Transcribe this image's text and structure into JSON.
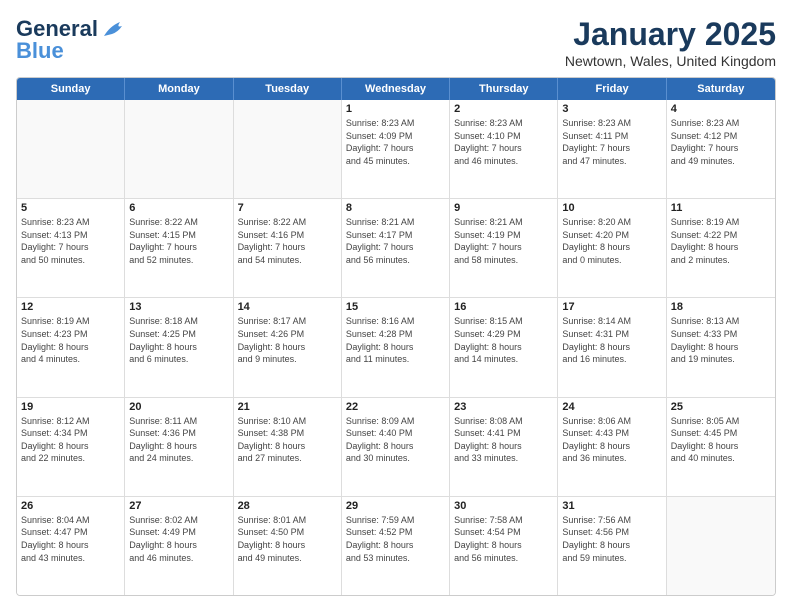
{
  "logo": {
    "line1": "General",
    "line2": "Blue"
  },
  "title": "January 2025",
  "subtitle": "Newtown, Wales, United Kingdom",
  "days": [
    "Sunday",
    "Monday",
    "Tuesday",
    "Wednesday",
    "Thursday",
    "Friday",
    "Saturday"
  ],
  "weeks": [
    [
      {
        "day": "",
        "info": ""
      },
      {
        "day": "",
        "info": ""
      },
      {
        "day": "",
        "info": ""
      },
      {
        "day": "1",
        "info": "Sunrise: 8:23 AM\nSunset: 4:09 PM\nDaylight: 7 hours\nand 45 minutes."
      },
      {
        "day": "2",
        "info": "Sunrise: 8:23 AM\nSunset: 4:10 PM\nDaylight: 7 hours\nand 46 minutes."
      },
      {
        "day": "3",
        "info": "Sunrise: 8:23 AM\nSunset: 4:11 PM\nDaylight: 7 hours\nand 47 minutes."
      },
      {
        "day": "4",
        "info": "Sunrise: 8:23 AM\nSunset: 4:12 PM\nDaylight: 7 hours\nand 49 minutes."
      }
    ],
    [
      {
        "day": "5",
        "info": "Sunrise: 8:23 AM\nSunset: 4:13 PM\nDaylight: 7 hours\nand 50 minutes."
      },
      {
        "day": "6",
        "info": "Sunrise: 8:22 AM\nSunset: 4:15 PM\nDaylight: 7 hours\nand 52 minutes."
      },
      {
        "day": "7",
        "info": "Sunrise: 8:22 AM\nSunset: 4:16 PM\nDaylight: 7 hours\nand 54 minutes."
      },
      {
        "day": "8",
        "info": "Sunrise: 8:21 AM\nSunset: 4:17 PM\nDaylight: 7 hours\nand 56 minutes."
      },
      {
        "day": "9",
        "info": "Sunrise: 8:21 AM\nSunset: 4:19 PM\nDaylight: 7 hours\nand 58 minutes."
      },
      {
        "day": "10",
        "info": "Sunrise: 8:20 AM\nSunset: 4:20 PM\nDaylight: 8 hours\nand 0 minutes."
      },
      {
        "day": "11",
        "info": "Sunrise: 8:19 AM\nSunset: 4:22 PM\nDaylight: 8 hours\nand 2 minutes."
      }
    ],
    [
      {
        "day": "12",
        "info": "Sunrise: 8:19 AM\nSunset: 4:23 PM\nDaylight: 8 hours\nand 4 minutes."
      },
      {
        "day": "13",
        "info": "Sunrise: 8:18 AM\nSunset: 4:25 PM\nDaylight: 8 hours\nand 6 minutes."
      },
      {
        "day": "14",
        "info": "Sunrise: 8:17 AM\nSunset: 4:26 PM\nDaylight: 8 hours\nand 9 minutes."
      },
      {
        "day": "15",
        "info": "Sunrise: 8:16 AM\nSunset: 4:28 PM\nDaylight: 8 hours\nand 11 minutes."
      },
      {
        "day": "16",
        "info": "Sunrise: 8:15 AM\nSunset: 4:29 PM\nDaylight: 8 hours\nand 14 minutes."
      },
      {
        "day": "17",
        "info": "Sunrise: 8:14 AM\nSunset: 4:31 PM\nDaylight: 8 hours\nand 16 minutes."
      },
      {
        "day": "18",
        "info": "Sunrise: 8:13 AM\nSunset: 4:33 PM\nDaylight: 8 hours\nand 19 minutes."
      }
    ],
    [
      {
        "day": "19",
        "info": "Sunrise: 8:12 AM\nSunset: 4:34 PM\nDaylight: 8 hours\nand 22 minutes."
      },
      {
        "day": "20",
        "info": "Sunrise: 8:11 AM\nSunset: 4:36 PM\nDaylight: 8 hours\nand 24 minutes."
      },
      {
        "day": "21",
        "info": "Sunrise: 8:10 AM\nSunset: 4:38 PM\nDaylight: 8 hours\nand 27 minutes."
      },
      {
        "day": "22",
        "info": "Sunrise: 8:09 AM\nSunset: 4:40 PM\nDaylight: 8 hours\nand 30 minutes."
      },
      {
        "day": "23",
        "info": "Sunrise: 8:08 AM\nSunset: 4:41 PM\nDaylight: 8 hours\nand 33 minutes."
      },
      {
        "day": "24",
        "info": "Sunrise: 8:06 AM\nSunset: 4:43 PM\nDaylight: 8 hours\nand 36 minutes."
      },
      {
        "day": "25",
        "info": "Sunrise: 8:05 AM\nSunset: 4:45 PM\nDaylight: 8 hours\nand 40 minutes."
      }
    ],
    [
      {
        "day": "26",
        "info": "Sunrise: 8:04 AM\nSunset: 4:47 PM\nDaylight: 8 hours\nand 43 minutes."
      },
      {
        "day": "27",
        "info": "Sunrise: 8:02 AM\nSunset: 4:49 PM\nDaylight: 8 hours\nand 46 minutes."
      },
      {
        "day": "28",
        "info": "Sunrise: 8:01 AM\nSunset: 4:50 PM\nDaylight: 8 hours\nand 49 minutes."
      },
      {
        "day": "29",
        "info": "Sunrise: 7:59 AM\nSunset: 4:52 PM\nDaylight: 8 hours\nand 53 minutes."
      },
      {
        "day": "30",
        "info": "Sunrise: 7:58 AM\nSunset: 4:54 PM\nDaylight: 8 hours\nand 56 minutes."
      },
      {
        "day": "31",
        "info": "Sunrise: 7:56 AM\nSunset: 4:56 PM\nDaylight: 8 hours\nand 59 minutes."
      },
      {
        "day": "",
        "info": ""
      }
    ]
  ]
}
